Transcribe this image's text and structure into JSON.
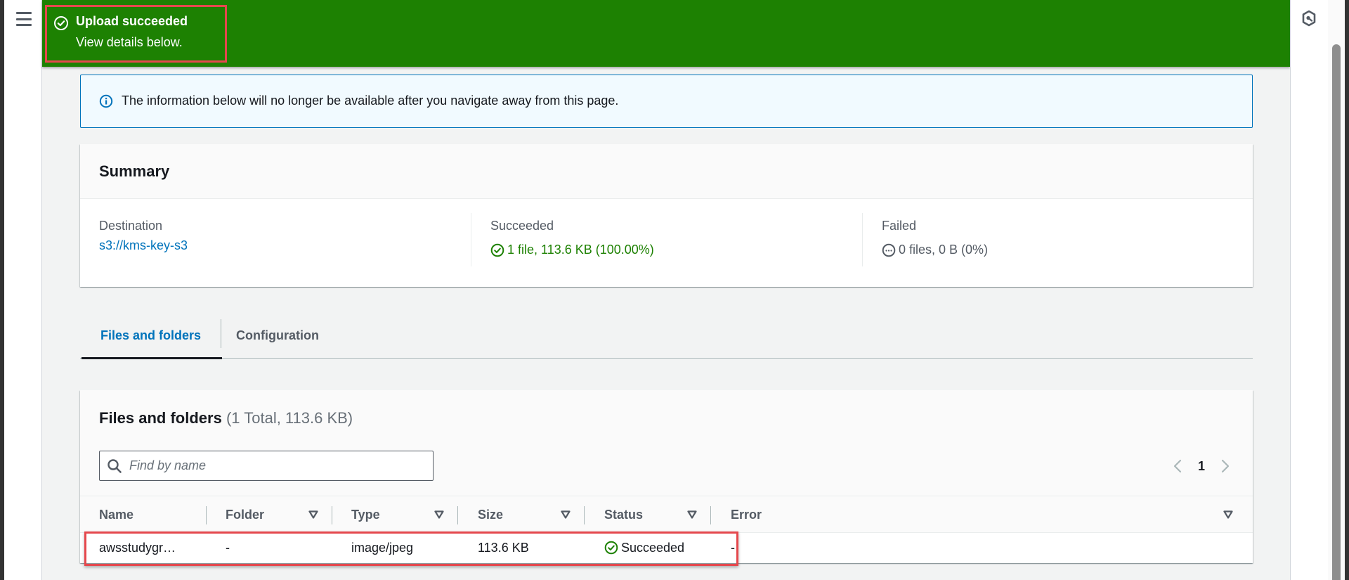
{
  "nav": {
    "menu_icon": "hamburger-menu-icon"
  },
  "flash": {
    "icon": "check-circle-icon",
    "title": "Upload succeeded",
    "subtitle": "View details below.",
    "color": "#1d8102"
  },
  "info_alert": {
    "icon": "info-circle-icon",
    "text": "The information below will no longer be available after you navigate away from this page."
  },
  "summary": {
    "title": "Summary",
    "destination": {
      "label": "Destination",
      "value": "s3://kms-key-s3"
    },
    "succeeded": {
      "label": "Succeeded",
      "icon": "check-circle-icon",
      "value": "1 file, 113.6 KB (100.00%)"
    },
    "failed": {
      "label": "Failed",
      "icon": "ellipsis-circle-icon",
      "value": "0 files, 0 B (0%)"
    }
  },
  "tabs": [
    {
      "label": "Files and folders",
      "active": true
    },
    {
      "label": "Configuration",
      "active": false
    }
  ],
  "files_panel": {
    "title": "Files and folders",
    "count": "(1 Total, 113.6 KB)",
    "search_placeholder": "Find by name",
    "search_value": "",
    "pagination": {
      "current_page": "1"
    },
    "columns": [
      "Name",
      "Folder",
      "Type",
      "Size",
      "Status",
      "Error"
    ],
    "rows": [
      {
        "name": "awsstudygr…",
        "folder": "-",
        "type": "image/jpeg",
        "size": "113.6 KB",
        "status": "Succeeded",
        "error": "-"
      }
    ]
  },
  "colors": {
    "success": "#1d8102",
    "link": "#0073bb",
    "highlight_box": "#e5484d",
    "info_bg": "#f1faff"
  }
}
